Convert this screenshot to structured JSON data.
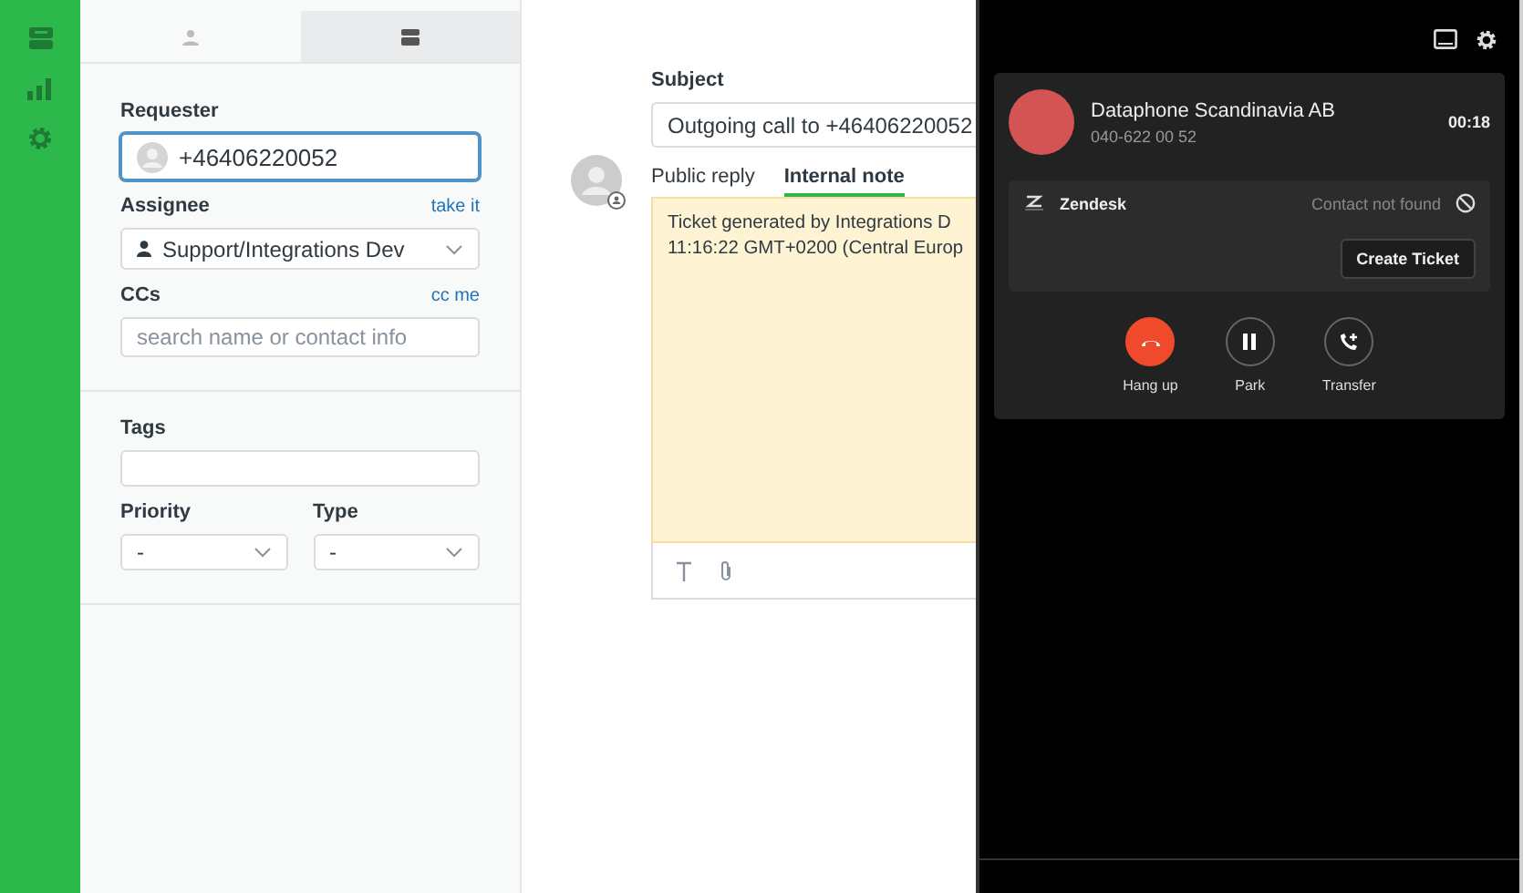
{
  "panel_tabs": [
    {
      "kind": "user",
      "selected": false
    },
    {
      "kind": "organization",
      "selected": true
    }
  ],
  "requester": {
    "label": "Requester",
    "value": "+46406220052"
  },
  "assignee": {
    "label": "Assignee",
    "link": "take it",
    "value": "Support/Integrations Dev"
  },
  "ccs": {
    "label": "CCs",
    "link": "cc me",
    "placeholder": "search name or contact info"
  },
  "tags": {
    "label": "Tags"
  },
  "priority": {
    "label": "Priority",
    "value": "-"
  },
  "type": {
    "label": "Type",
    "value": "-"
  },
  "subject": {
    "label": "Subject",
    "value": "Outgoing call to +46406220052"
  },
  "reply_tabs": [
    {
      "label": "Public reply",
      "selected": false
    },
    {
      "label": "Internal note",
      "selected": true
    }
  ],
  "note": {
    "lines": [
      "Ticket generated by Integrations D",
      "11:16:22 GMT+0200 (Central Europ"
    ]
  },
  "call": {
    "name": "Dataphone Scandinavia AB",
    "number": "040-622 00 52",
    "timer": "00:18",
    "crm": {
      "name": "Zendesk",
      "status": "Contact not found",
      "button": "Create Ticket"
    },
    "actions": [
      {
        "kind": "hangup",
        "label": "Hang up"
      },
      {
        "kind": "park",
        "label": "Park"
      },
      {
        "kind": "transfer",
        "label": "Transfer"
      }
    ]
  }
}
